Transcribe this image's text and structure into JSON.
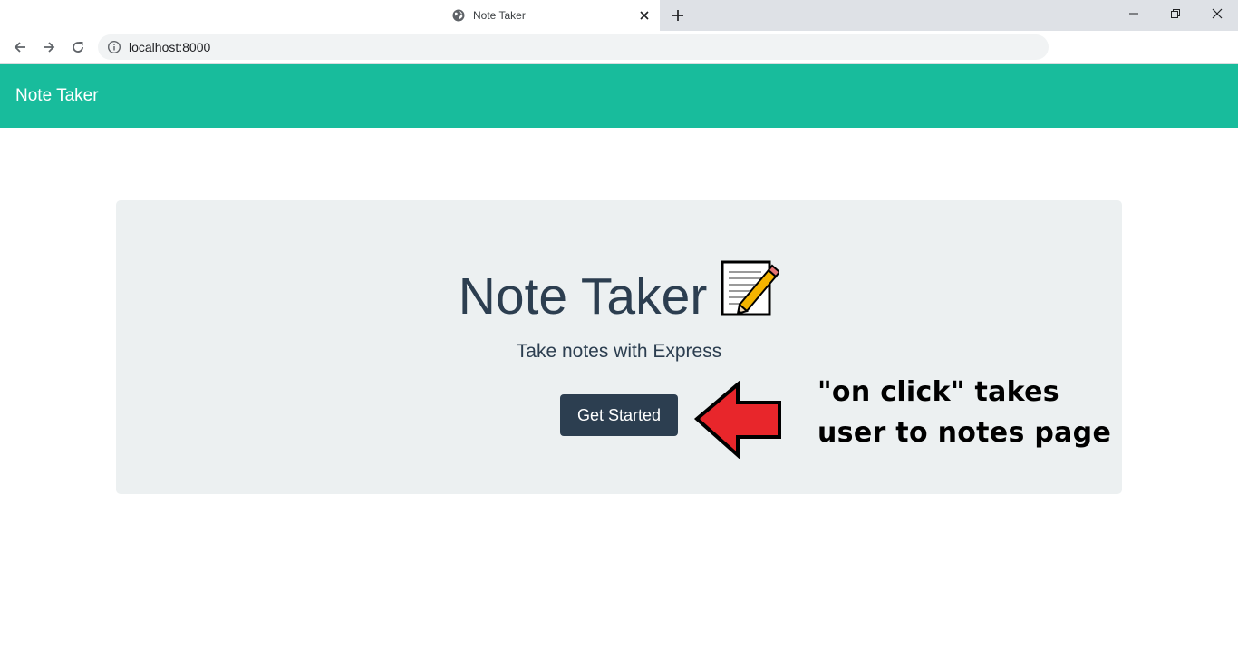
{
  "browser": {
    "tab_title": "Note Taker",
    "url": "localhost:8000"
  },
  "navbar": {
    "brand": "Note Taker",
    "color": "#18bc9c"
  },
  "hero": {
    "title": "Note Taker",
    "title_emoji": "📝",
    "subtitle": "Take notes with Express",
    "button_label": "Get Started",
    "button_color": "#2c3e50",
    "background": "#ecf0f1"
  },
  "annotation": {
    "line1": "\"on click\" takes",
    "line2": "user to notes page",
    "arrow_color": "#e8262b"
  },
  "icons": {
    "tab_favicon": "globe-icon",
    "tab_close": "close-icon",
    "new_tab": "plus-icon",
    "back": "arrow-left-icon",
    "forward": "arrow-right-icon",
    "reload": "reload-icon",
    "site_info": "info-icon",
    "minimize": "minimize-icon",
    "restore": "restore-icon",
    "close_window": "close-icon"
  }
}
